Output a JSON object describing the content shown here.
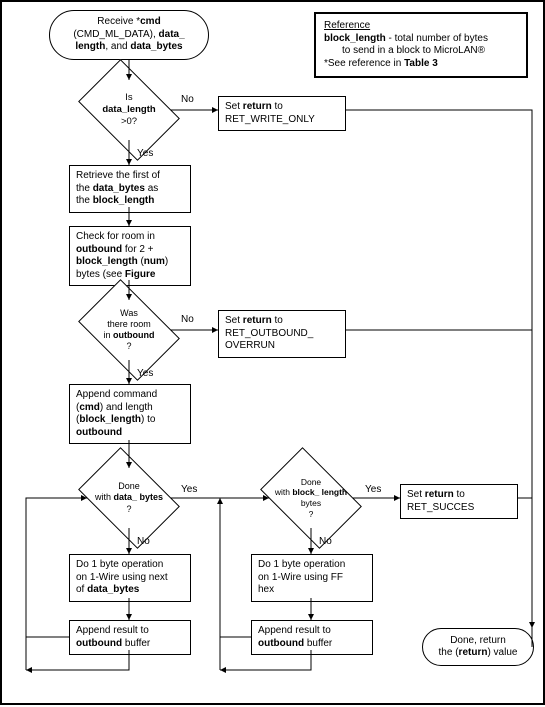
{
  "chart_data": {
    "type": "flowchart",
    "title": "CMD_ML_DATA handling",
    "nodes": [
      {
        "id": "start",
        "type": "terminator",
        "text": "Receive *cmd (CMD_ML_DATA), data_length, and data_bytes"
      },
      {
        "id": "d1",
        "type": "decision",
        "text": "Is data_length > 0?",
        "yes": "p1",
        "no": "p_ret_write"
      },
      {
        "id": "p_ret_write",
        "type": "process",
        "text": "Set return to RET_WRITE_ONLY"
      },
      {
        "id": "p1",
        "type": "process",
        "text": "Retrieve the first of the data_bytes as the block_length"
      },
      {
        "id": "p2",
        "type": "process",
        "text": "Check for room in outbound for 2 + block_length (num) bytes (see Figure"
      },
      {
        "id": "d2",
        "type": "decision",
        "text": "Was there room in outbound ?",
        "yes": "p3",
        "no": "p_ret_overrun"
      },
      {
        "id": "p_ret_overrun",
        "type": "process",
        "text": "Set return to RET_OUTBOUND_OVERRUN"
      },
      {
        "id": "p3",
        "type": "process",
        "text": "Append command (cmd) and length (block_length) to outbound"
      },
      {
        "id": "d3",
        "type": "decision",
        "text": "Done with data_bytes ?",
        "yes": "d4",
        "no": "p4"
      },
      {
        "id": "p4",
        "type": "process",
        "text": "Do 1 byte operation on 1-Wire using next of data_bytes"
      },
      {
        "id": "p5",
        "type": "process",
        "text": "Append result to outbound buffer"
      },
      {
        "id": "d4",
        "type": "decision",
        "text": "Done with block_length bytes ?",
        "yes": "p_ret_success",
        "no": "p6"
      },
      {
        "id": "p6",
        "type": "process",
        "text": "Do 1 byte operation on 1-Wire using FF hex"
      },
      {
        "id": "p7",
        "type": "process",
        "text": "Append result to outbound buffer"
      },
      {
        "id": "p_ret_success",
        "type": "process",
        "text": "Set return to RET_SUCCES"
      },
      {
        "id": "end",
        "type": "terminator",
        "text": "Done, return the (return) value"
      }
    ],
    "reference": {
      "title": "Reference",
      "lines": [
        "block_length - total number of bytes to send in a block to MicroLAN®",
        "*See reference in Table 3"
      ]
    }
  },
  "labels": {
    "yes": "Yes",
    "no": "No"
  },
  "start": {
    "l1": "Receive *",
    "cmd": "cmd",
    "l2": "(CMD_ML_DATA), ",
    "dl": "data_",
    "l3": "length",
    "l4": ", and ",
    "db": "data_bytes"
  },
  "d1": {
    "pre": "Is",
    "var": "data_length",
    "post": ">0?"
  },
  "retwrite": {
    "pre": "Set ",
    "ret": "return",
    "post": " to",
    "val": "RET_WRITE_ONLY"
  },
  "p1": {
    "l1": "Retrieve the first of",
    "l2": "the ",
    "v1": "data_bytes",
    "l3": " as",
    "l4": "the ",
    "v2": "block_length"
  },
  "p2": {
    "l1": "Check for room in",
    "v1": "outbound",
    "l2": " for 2 +",
    "v2": "block_length",
    "l3": " (",
    "v3": "num",
    "l4": ")",
    "l5": "bytes  (see ",
    "v4": "Figure"
  },
  "d2": {
    "l1": "Was",
    "l2": "there room",
    "l3": "in ",
    "v": "outbound",
    "l4": "?"
  },
  "retoverrun": {
    "pre": "Set ",
    "ret": "return",
    "post": " to",
    "val": "RET_OUTBOUND_ OVERRUN"
  },
  "p3": {
    "l1": "Append command",
    "l2": "(",
    "v1": "cmd",
    "l3": ") and length",
    "l4": "(",
    "v2": "block_length",
    "l5": ") to",
    "v3": "outbound"
  },
  "d3": {
    "l1": "Done",
    "l2": "with ",
    "v": "data_ bytes",
    "l3": "?"
  },
  "p4": {
    "l1": "Do 1 byte operation",
    "l2": "on 1-Wire using next",
    "l3": "of ",
    "v": "data_bytes"
  },
  "p5": {
    "l1": "Append result to",
    "v": "outbound",
    "l2": " buffer"
  },
  "d4": {
    "l1": "Done",
    "l2": "with ",
    "v": "block_ length",
    "l3": " bytes",
    "l4": "?"
  },
  "p6": {
    "l1": "Do 1 byte operation",
    "l2": "on 1-Wire using FF",
    "l3": "hex"
  },
  "p7": {
    "l1": "Append result to",
    "v": "outbound",
    "l2": " buffer"
  },
  "retsuccess": {
    "pre": "Set ",
    "ret": "return",
    "post": " to",
    "val": "RET_SUCCES"
  },
  "end": {
    "l1": "Done, return",
    "l2": "the (",
    "v": "return",
    "l3": ") value"
  },
  "ref": {
    "title": "Reference",
    "v1": "block_length",
    "l1": " - total number of bytes",
    "l2": "to send in a block to MicroLAN®",
    "l3": "*See reference in ",
    "v2": "Table 3"
  }
}
